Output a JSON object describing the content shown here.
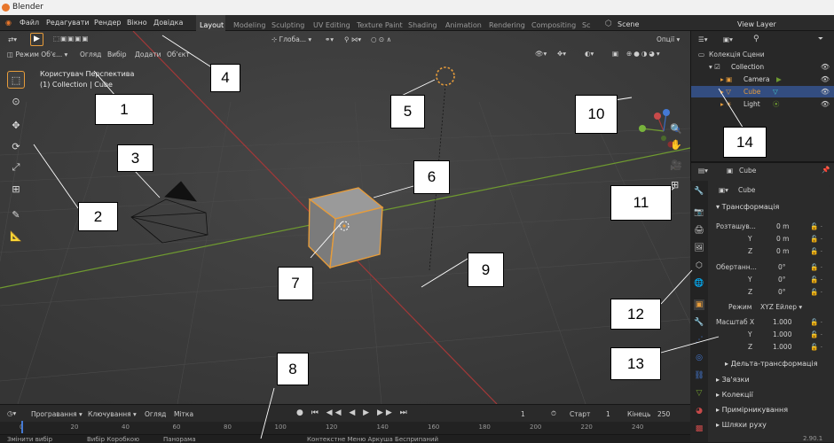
{
  "window": {
    "title": "Blender"
  },
  "menus": [
    "Файл",
    "Редагувати",
    "Рендер",
    "Вікно",
    "Довідка"
  ],
  "workspaces": [
    "Layout",
    "Modeling",
    "Sculpting",
    "UV Editing",
    "Texture Paint",
    "Shading",
    "Animation",
    "Rendering",
    "Compositing",
    "Sc"
  ],
  "scene": {
    "label": "Scene",
    "view_layer": "View Layer"
  },
  "viewport": {
    "mode": "Режим Об'є...",
    "menus": [
      "Огляд",
      "Вибір",
      "Додати",
      "Об'єкт"
    ],
    "orientation": "Глоба...",
    "options": "Опції",
    "perspective_label": "Користувач Перспектива",
    "collection_label": "(1) Collection | Cube"
  },
  "timeline": {
    "menus": [
      "Програвання",
      "Ключування",
      "Огляд",
      "Мітка"
    ],
    "current_frame": "1",
    "start_label": "Старт",
    "start_value": "1",
    "end_label": "Кінець",
    "end_value": "250",
    "ruler": [
      "0",
      "20",
      "40",
      "60",
      "80",
      "100",
      "120",
      "140",
      "160",
      "180",
      "200",
      "220",
      "240"
    ]
  },
  "statusbar": {
    "left": "Змінити вибір",
    "mid": "Вибір Коробкою",
    "pan": "Панорама",
    "right": "Контекстне Меню Аркуша Бесприпаний",
    "version": "2.90.1"
  },
  "outliner": {
    "root": "Колекція Сцени",
    "items": [
      {
        "label": "Collection",
        "level": 1
      },
      {
        "label": "Camera",
        "level": 2
      },
      {
        "label": "Cube",
        "level": 2,
        "selected": true
      },
      {
        "label": "Light",
        "level": 2
      }
    ]
  },
  "properties": {
    "object_name": "Cube",
    "data_name": "Cube",
    "transform_title": "Трансформація",
    "location_label": "Розташув...",
    "location": [
      "0 m",
      "0 m",
      "0 m"
    ],
    "rotation_label": "Обертанн...",
    "rotation": [
      "0°",
      "0°",
      "0°"
    ],
    "mode_label": "Режим",
    "mode_value": "XYZ Ейлер",
    "scale_label": "Масштаб X",
    "scale": [
      "1.000",
      "1.000",
      "1.000"
    ],
    "axes": [
      "X",
      "Y",
      "Z"
    ],
    "delta": "Дельта-трансформація",
    "sections": [
      "Зв'язки",
      "Колекції",
      "Примірникування",
      "Шляхи руху"
    ]
  },
  "callouts": [
    "1",
    "2",
    "3",
    "4",
    "5",
    "6",
    "7",
    "8",
    "9",
    "10",
    "11",
    "12",
    "13",
    "14"
  ],
  "colors": {
    "accent": "#e69c3b",
    "selection": "#334d80",
    "x_axis": "#a33838",
    "y_axis": "#6f9a30"
  }
}
